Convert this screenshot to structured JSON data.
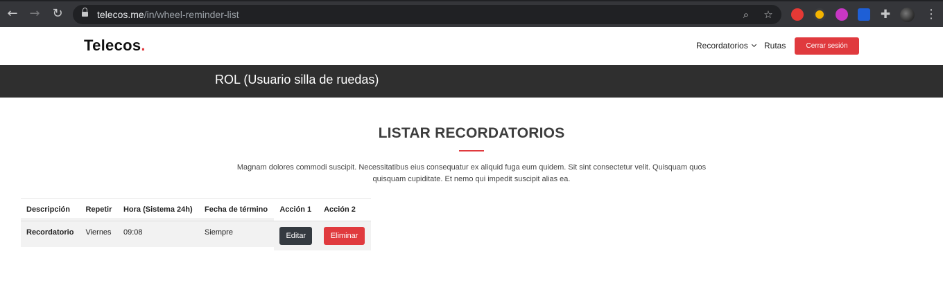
{
  "browser": {
    "url_host": "telecos.me",
    "url_path": "/in/wheel-reminder-list",
    "icons": {
      "back": "back-arrow-icon",
      "forward": "forward-arrow-icon",
      "reload": "reload-icon",
      "zoom": "zoom-icon",
      "bookmark": "star-icon",
      "extensions": "puzzle-icon",
      "menu": "kebab-menu-icon"
    }
  },
  "header": {
    "logo_text": "Telecos",
    "logo_dot": ".",
    "nav": {
      "recordatorios": "Recordatorios",
      "rutas": "Rutas",
      "logout": "Cerrar sesión"
    }
  },
  "banner": {
    "title": "ROL (Usuario silla de ruedas)"
  },
  "section": {
    "title": "LISTAR RECORDATORIOS",
    "description": "Magnam dolores commodi suscipit. Necessitatibus eius consequatur ex aliquid fuga eum quidem. Sit sint consectetur velit. Quisquam quos quisquam cupiditate. Et nemo qui impedit suscipit alias ea."
  },
  "table": {
    "headers": [
      "Descripción",
      "Repetir",
      "Hora (Sistema 24h)",
      "Fecha de término",
      "Acción 1",
      "Acción 2"
    ],
    "rows": [
      {
        "descripcion": "Recordatorio",
        "repetir": "Viernes",
        "hora": "09:08",
        "fecha": "Siempre",
        "accion1": "Editar",
        "accion2": "Eliminar"
      }
    ]
  },
  "colors": {
    "accent": "#e03a3e",
    "banner": "#2f2f2f",
    "edit_button": "#343a40"
  }
}
